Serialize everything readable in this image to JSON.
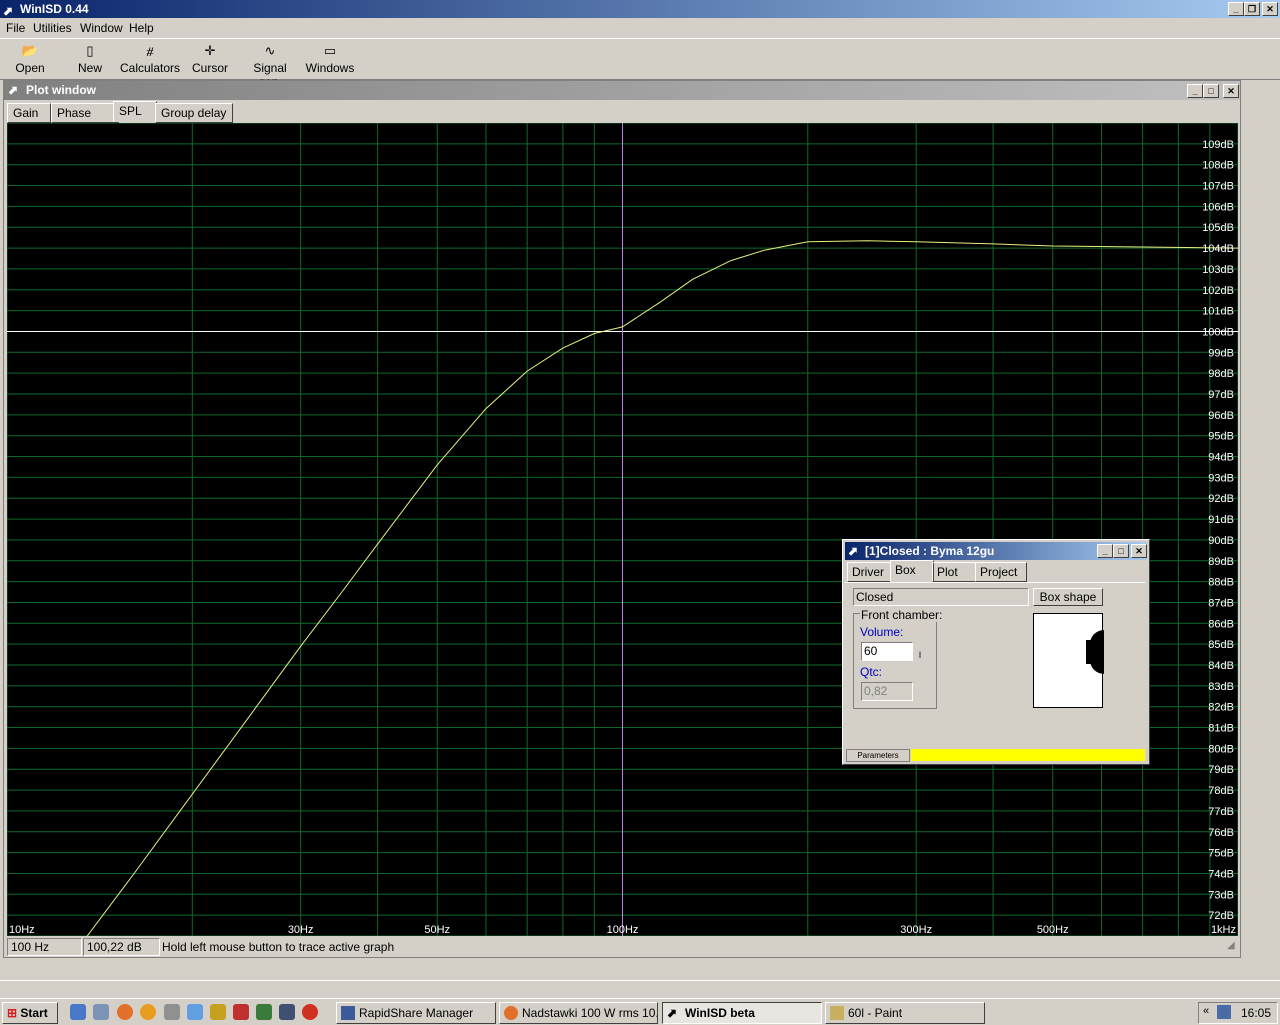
{
  "app": {
    "title": "WinISD 0.44"
  },
  "menu": [
    "File",
    "Utilities",
    "Window",
    "Help"
  ],
  "toolbar": [
    {
      "label": "Open",
      "icon": "folder-open-icon",
      "glyph": "📂"
    },
    {
      "label": "New",
      "icon": "new-document-icon",
      "glyph": "▯"
    },
    {
      "label": "Calculators",
      "icon": "calculator-icon",
      "glyph": "⧣"
    },
    {
      "label": "Cursor",
      "icon": "crosshair-icon",
      "glyph": "✛"
    },
    {
      "label": "Signal gen.",
      "icon": "sine-wave-icon",
      "glyph": "∿"
    },
    {
      "label": "Windows",
      "icon": "window-icon",
      "glyph": "▭"
    }
  ],
  "plot_window": {
    "title": "Plot window",
    "tabs": [
      {
        "label": "Gain",
        "active": false
      },
      {
        "label": "Phase plot",
        "active": false
      },
      {
        "label": "SPL",
        "active": true
      },
      {
        "label": "Group delay",
        "active": false
      }
    ],
    "status": {
      "freq": "100 Hz",
      "level": "100,22 dB",
      "hint": "Hold left mouse button to trace active graph"
    }
  },
  "chart_data": {
    "type": "line",
    "title": "",
    "xlabel": "",
    "ylabel": "",
    "x_scale": "log",
    "xlim": [
      10,
      1000
    ],
    "ylim": [
      71,
      110
    ],
    "x_tick_labels": [
      {
        "value": 10,
        "label": "10Hz"
      },
      {
        "value": 30,
        "label": "30Hz"
      },
      {
        "value": 50,
        "label": "50Hz"
      },
      {
        "value": 100,
        "label": "100Hz"
      },
      {
        "value": 300,
        "label": "300Hz"
      },
      {
        "value": 500,
        "label": "500Hz"
      },
      {
        "value": 1000,
        "label": "1kHz"
      }
    ],
    "y_tick_labels": [
      "72dB",
      "73dB",
      "74dB",
      "75dB",
      "76dB",
      "77dB",
      "78dB",
      "79dB",
      "80dB",
      "81dB",
      "82dB",
      "83dB",
      "84dB",
      "85dB",
      "86dB",
      "87dB",
      "88dB",
      "89dB",
      "90dB",
      "91dB",
      "92dB",
      "93dB",
      "94dB",
      "95dB",
      "96dB",
      "97dB",
      "98dB",
      "99dB",
      "100dB",
      "101dB",
      "102dB",
      "103dB",
      "104dB",
      "105dB",
      "106dB",
      "107dB",
      "108dB",
      "109dB"
    ],
    "grid": true,
    "cursor_x": 100,
    "reference_y": 100,
    "series": [
      {
        "color": "#e8f080",
        "x": [
          13.5,
          16,
          20,
          25,
          30,
          35,
          40,
          50,
          60,
          70,
          80,
          90,
          100,
          115,
          130,
          150,
          170,
          200,
          250,
          300,
          400,
          500,
          700,
          1000
        ],
        "y": [
          71,
          73.9,
          77.8,
          81.7,
          84.9,
          87.5,
          89.8,
          93.6,
          96.3,
          98.1,
          99.2,
          99.9,
          100.22,
          101.4,
          102.5,
          103.4,
          103.9,
          104.3,
          104.35,
          104.3,
          104.2,
          104.1,
          104.05,
          104.0
        ]
      }
    ]
  },
  "box_dialog": {
    "title": "[1]Closed : Byma 12gu",
    "tabs": [
      {
        "label": "Driver",
        "active": false
      },
      {
        "label": "Box",
        "active": true
      },
      {
        "label": "Plot",
        "active": false
      },
      {
        "label": "Project",
        "active": false
      }
    ],
    "box_type": "Closed",
    "box_shape_button": "Box shape",
    "front_chamber_label": "Front chamber:",
    "volume_label": "Volume:",
    "volume_value": "60",
    "volume_unit": "l",
    "qtc_label": "Qtc:",
    "qtc_value": "0,82",
    "parameters_label": "Parameters",
    "parameters_bar_color": "#ffff00"
  },
  "taskbar": {
    "start_label": "Start",
    "tasks": [
      {
        "label": "RapidShare Manager",
        "active": false,
        "icon": "rapidshare-icon"
      },
      {
        "label": "Nadstawki 100 W rms 10...",
        "active": false,
        "icon": "firefox-icon"
      },
      {
        "label": "WinISD beta",
        "active": true,
        "icon": "winisd-icon"
      },
      {
        "label": "60l - Paint",
        "active": false,
        "icon": "paint-icon"
      }
    ],
    "clock": "16:05"
  }
}
